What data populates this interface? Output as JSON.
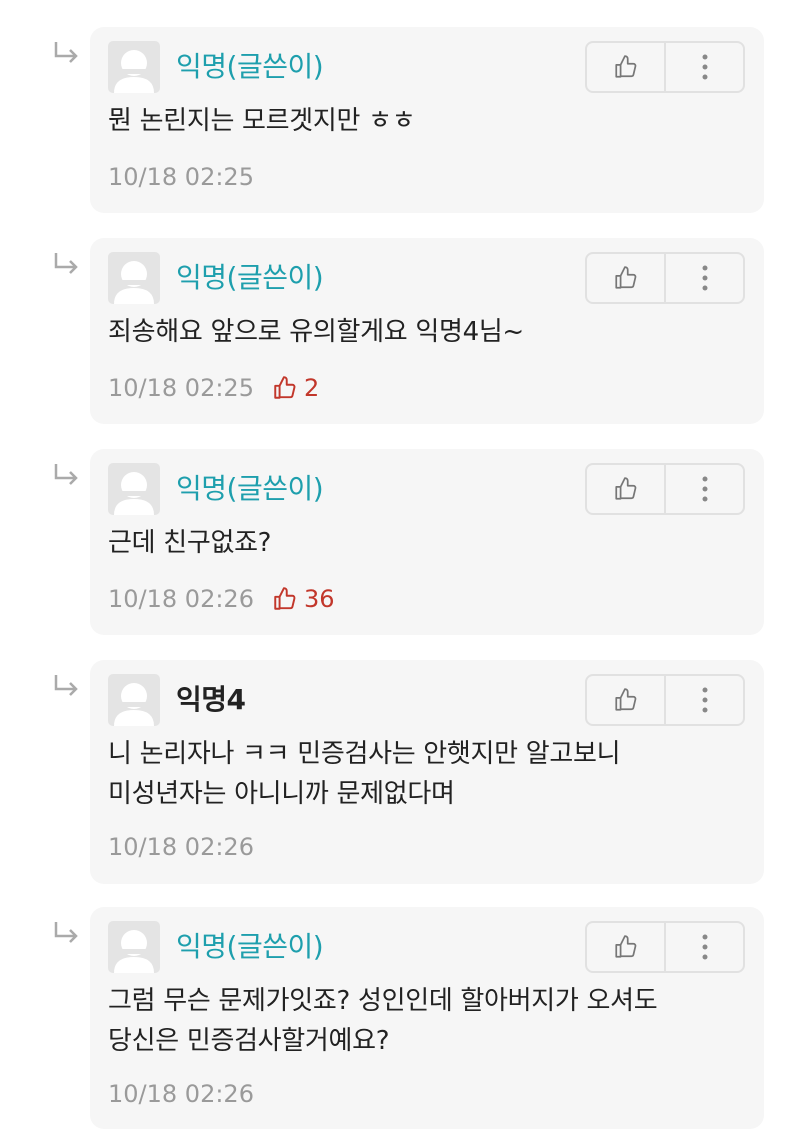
{
  "comments": [
    {
      "author": "익명(글쓴이)",
      "text_lines": [
        "뭔 논린지는 모르겟지만 ㅎㅎ"
      ],
      "time": "10/18 02:25",
      "votes": ""
    },
    {
      "author": "익명(글쓴이)",
      "text_lines": [
        "죄송해요 앞으로 유의할게요 익명4님~"
      ],
      "time": "10/18 02:25",
      "votes": "2"
    },
    {
      "author": "익명(글쓴이)",
      "text_lines": [
        "근데 친구없죠?"
      ],
      "time": "10/18 02:26",
      "votes": "36"
    },
    {
      "author": "익명4",
      "text_lines": [
        "니 논리자나 ㅋㅋ 민증검사는 안햇지만 알고보니",
        "미성년자는 아니니까 문제없다며"
      ],
      "time": "10/18 02:26",
      "votes": ""
    },
    {
      "author": "익명(글쓴이)",
      "text_lines": [
        "그럼 무슨 문제가잇죠? 성인인데 할아버지가 오셔도",
        "당신은 민증검사할거예요?"
      ],
      "time": "10/18 02:26",
      "votes": ""
    }
  ],
  "colors": {
    "op_author": "#1e9fad",
    "vote_count": "#c2372b",
    "card_bg": "#f6f6f6",
    "meta_text": "#9a9a9a"
  },
  "icons": {
    "reply": "reply-arrow-icon",
    "like": "thumbs-up-icon",
    "more": "more-vertical-icon",
    "avatar": "default-avatar-icon"
  }
}
